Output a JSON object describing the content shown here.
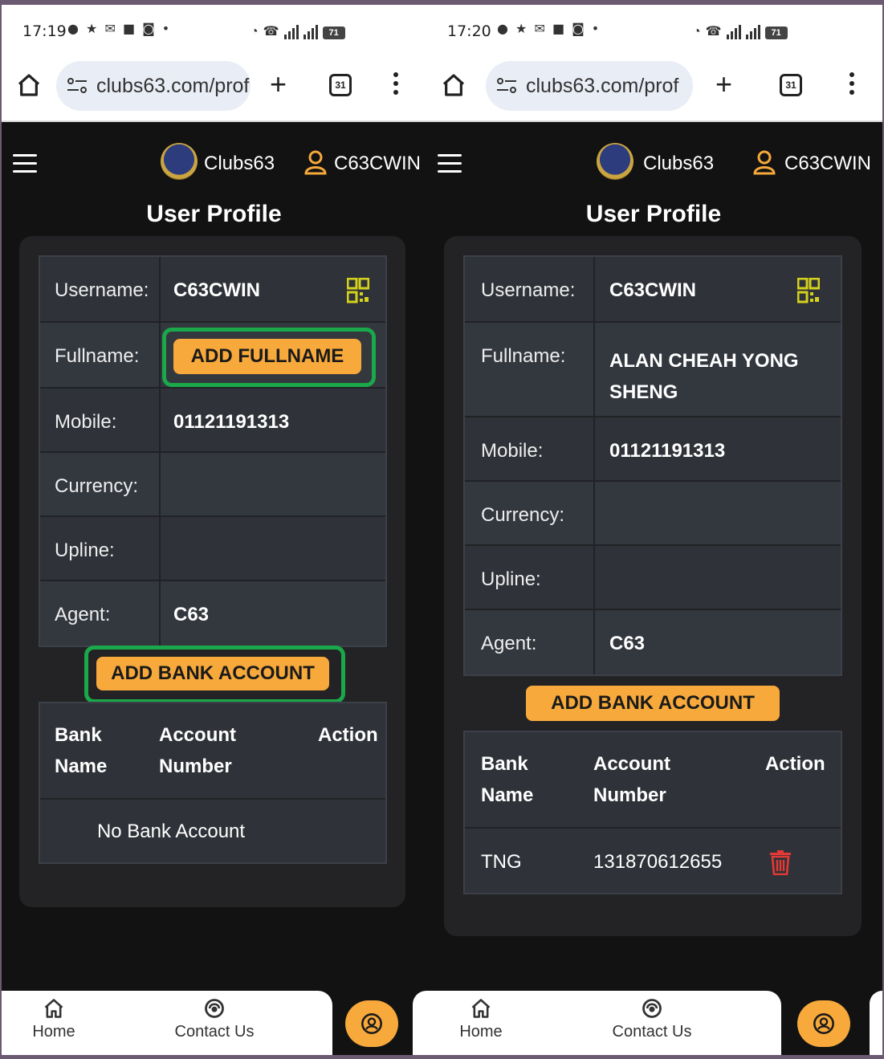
{
  "left": {
    "status": {
      "time": "17:19",
      "notif_icons": "● ★ ✉ ■ ◙ •",
      "battery": "71"
    },
    "browser": {
      "url": "clubs63.com/prof",
      "tab_count": "31"
    },
    "header": {
      "brand": "Clubs63",
      "user": "C63CWIN"
    },
    "title": "User Profile",
    "profile": {
      "username_label": "Username:",
      "username_value": "C63CWIN",
      "fullname_label": "Fullname:",
      "fullname_button": "ADD FULLNAME",
      "mobile_label": "Mobile:",
      "mobile_value": "01121191313",
      "currency_label": "Currency:",
      "upline_label": "Upline:",
      "agent_label": "Agent:",
      "agent_value": "C63"
    },
    "add_bank_button": "ADD BANK ACCOUNT",
    "bank_table": {
      "col_bank_1": "Bank",
      "col_bank_2": "Name",
      "col_acct_1": "Account",
      "col_acct_2": "Number",
      "col_action": "Action",
      "empty": "No Bank Account"
    },
    "bottom": {
      "home": "Home",
      "contact": "Contact Us"
    }
  },
  "right": {
    "status": {
      "time": "17:20",
      "notif_icons": "● ★ ✉ ■ ◙ •",
      "battery": "71"
    },
    "browser": {
      "url": "clubs63.com/prof",
      "tab_count": "31"
    },
    "header": {
      "brand": "Clubs63",
      "user": "C63CWIN"
    },
    "title": "User Profile",
    "profile": {
      "username_label": "Username:",
      "username_value": "C63CWIN",
      "fullname_label": "Fullname:",
      "fullname_value_1": "ALAN CHEAH YONG",
      "fullname_value_2": "SHENG",
      "mobile_label": "Mobile:",
      "mobile_value": "01121191313",
      "currency_label": "Currency:",
      "upline_label": "Upline:",
      "agent_label": "Agent:",
      "agent_value": "C63"
    },
    "add_bank_button": "ADD BANK ACCOUNT",
    "bank_table": {
      "col_bank_1": "Bank",
      "col_bank_2": "Name",
      "col_acct_1": "Account",
      "col_acct_2": "Number",
      "col_action": "Action",
      "rows": [
        {
          "bank": "TNG",
          "account": "131870612655"
        }
      ]
    },
    "bottom": {
      "home": "Home",
      "contact": "Contact Us"
    }
  },
  "colors": {
    "accent": "#f7a93b",
    "highlight": "#1aa84a",
    "delete": "#e53935",
    "background": "#121212"
  }
}
